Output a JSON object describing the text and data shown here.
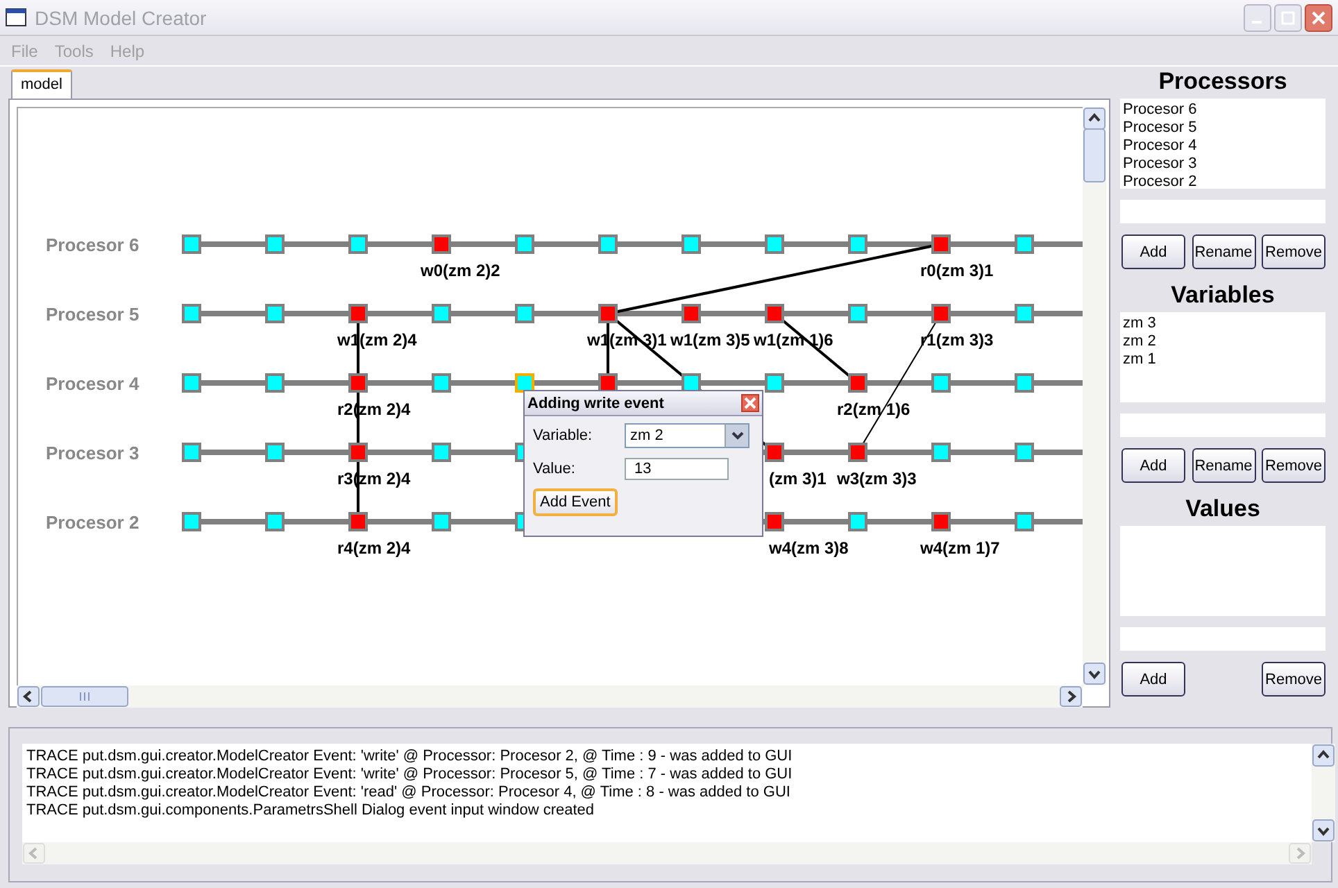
{
  "window": {
    "title": "DSM Model Creator"
  },
  "menu": [
    {
      "label": "File"
    },
    {
      "label": "Tools"
    },
    {
      "label": "Help"
    }
  ],
  "tabs": [
    {
      "label": "model",
      "selected": true
    }
  ],
  "diagram": {
    "rows": [
      {
        "name": "Procesor 6",
        "nodes": [
          {
            "kind": "plain"
          },
          {
            "kind": "plain"
          },
          {
            "kind": "plain"
          },
          {
            "kind": "event",
            "label": "w0(zm 2)2"
          },
          {
            "kind": "plain"
          },
          {
            "kind": "plain"
          },
          {
            "kind": "plain"
          },
          {
            "kind": "plain"
          },
          {
            "kind": "plain"
          },
          {
            "kind": "event",
            "label": "r0(zm 3)1"
          },
          {
            "kind": "plain"
          }
        ]
      },
      {
        "name": "Procesor 5",
        "nodes": [
          {
            "kind": "plain"
          },
          {
            "kind": "plain"
          },
          {
            "kind": "event",
            "label": "w1(zm 2)4"
          },
          {
            "kind": "plain"
          },
          {
            "kind": "plain"
          },
          {
            "kind": "event",
            "label": "w1(zm 3)1"
          },
          {
            "kind": "event",
            "label": "w1(zm 3)5"
          },
          {
            "kind": "event",
            "label": "w1(zm 1)6"
          },
          {
            "kind": "plain"
          },
          {
            "kind": "event",
            "label": "r1(zm 3)3"
          },
          {
            "kind": "plain"
          }
        ]
      },
      {
        "name": "Procesor 4",
        "nodes": [
          {
            "kind": "plain"
          },
          {
            "kind": "plain"
          },
          {
            "kind": "event",
            "label": "r2(zm 2)4"
          },
          {
            "kind": "plain"
          },
          {
            "kind": "selected"
          },
          {
            "kind": "event"
          },
          {
            "kind": "plain"
          },
          {
            "kind": "plain"
          },
          {
            "kind": "event",
            "label": "r2(zm 1)6"
          },
          {
            "kind": "plain"
          },
          {
            "kind": "plain"
          }
        ]
      },
      {
        "name": "Procesor 3",
        "nodes": [
          {
            "kind": "plain"
          },
          {
            "kind": "plain"
          },
          {
            "kind": "event",
            "label": "r3(zm 2)4"
          },
          {
            "kind": "plain"
          },
          {
            "kind": "plain"
          },
          {
            "kind": "covered"
          },
          {
            "kind": "covered"
          },
          {
            "kind": "event",
            "label": "(zm 3)1"
          },
          {
            "kind": "event",
            "label": "w3(zm 3)3"
          },
          {
            "kind": "plain"
          },
          {
            "kind": "plain"
          }
        ]
      },
      {
        "name": "Procesor 2",
        "nodes": [
          {
            "kind": "plain"
          },
          {
            "kind": "plain"
          },
          {
            "kind": "event",
            "label": "r4(zm 2)4"
          },
          {
            "kind": "plain"
          },
          {
            "kind": "plain"
          },
          {
            "kind": "covered"
          },
          {
            "kind": "covered"
          },
          {
            "kind": "event",
            "label": "w4(zm 3)8"
          },
          {
            "kind": "plain"
          },
          {
            "kind": "event",
            "label": "w4(zm 1)7"
          },
          {
            "kind": "plain"
          }
        ]
      }
    ]
  },
  "dialog": {
    "title": "Adding write event",
    "fields": [
      {
        "label": "Variable:",
        "kind": "select",
        "value": "zm 2"
      },
      {
        "label": "Value:",
        "kind": "text",
        "value": "13"
      }
    ],
    "button": "Add Event"
  },
  "side": [
    {
      "title": "Processors",
      "items": [
        "Procesor 6",
        "Procesor 5",
        "Procesor 4",
        "Procesor 3",
        "Procesor 2"
      ],
      "buttons": [
        "Add",
        "Rename",
        "Remove"
      ]
    },
    {
      "title": "Variables",
      "items": [
        "zm 3",
        "zm 2",
        "zm 1"
      ],
      "buttons": [
        "Add",
        "Rename",
        "Remove"
      ]
    },
    {
      "title": "Values",
      "buttons": [
        "Add",
        "Remove"
      ]
    }
  ],
  "log": {
    "lines": [
      "TRACE put.dsm.gui.creator.ModelCreator Event: 'write' @ Processor: Procesor 2, @ Time : 9 - was added to GUI",
      "TRACE put.dsm.gui.creator.ModelCreator Event: 'write' @ Processor: Procesor 5, @ Time : 7 - was added to GUI",
      "TRACE put.dsm.gui.creator.ModelCreator Event: 'read' @ Processor: Procesor 4, @ Time : 8 - was added to GUI",
      "TRACE put.dsm.gui.components.ParametrsShell Dialog event input window created"
    ]
  }
}
